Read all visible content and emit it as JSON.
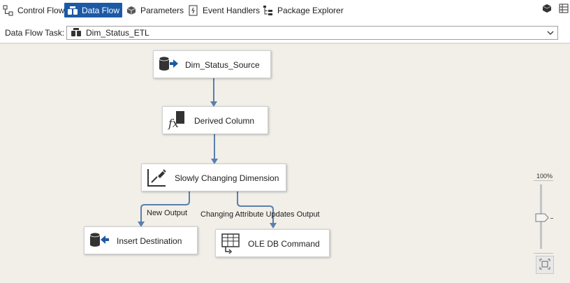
{
  "tabs": [
    {
      "label": "Control Flow",
      "icon": "control-flow-icon",
      "active": false
    },
    {
      "label": "Data Flow",
      "icon": "data-flow-icon",
      "active": true
    },
    {
      "label": "Parameters",
      "icon": "parameters-icon",
      "active": false
    },
    {
      "label": "Event Handlers",
      "icon": "event-handlers-icon",
      "active": false
    },
    {
      "label": "Package Explorer",
      "icon": "package-explorer-icon",
      "active": false
    }
  ],
  "task": {
    "label": "Data Flow Task:",
    "selected": "Dim_Status_ETL"
  },
  "components": [
    {
      "label": "Dim_Status_Source",
      "icon": "ole-db-source-icon"
    },
    {
      "label": "Derived Column",
      "icon": "derived-column-icon"
    },
    {
      "label": "Slowly Changing Dimension",
      "icon": "scd-icon"
    },
    {
      "label": "Insert Destination",
      "icon": "ole-db-destination-icon"
    },
    {
      "label": "OLE DB Command",
      "icon": "ole-db-command-icon"
    }
  ],
  "paths": {
    "new_output": "New Output",
    "changing_output": "Changing Attribute Updates Output"
  },
  "zoom": {
    "level": "100%"
  },
  "colors": {
    "active_tab": "#1c5aa6",
    "canvas": "#f1efe8",
    "connector": "#5a7fae"
  }
}
